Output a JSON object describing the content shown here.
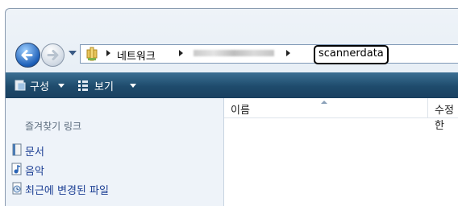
{
  "address_bar": {
    "crumbs": [
      "네트워크",
      "scannerdata"
    ],
    "current_folder": "scannerdata"
  },
  "command_bar": {
    "organize_label": "구성",
    "view_label": "보기"
  },
  "nav_pane": {
    "header": "즐겨찾기 링크",
    "links": [
      {
        "label": "문서",
        "icon": "documents-icon"
      },
      {
        "label": "음악",
        "icon": "music-icon"
      },
      {
        "label": "최근에 변경된 파일",
        "icon": "recent-files-icon"
      }
    ]
  },
  "columns": {
    "name": "이름",
    "modified": "수정한"
  },
  "colors": {
    "command_bar": "#1e4b6c",
    "link_text": "#1c3f94",
    "nav_pane_bg": "#eef3f9"
  }
}
